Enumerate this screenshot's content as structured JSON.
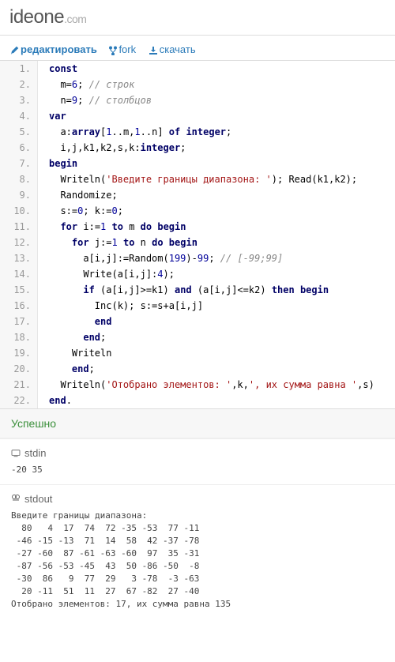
{
  "logo": {
    "main": "ideone",
    "ext": ".com"
  },
  "toolbar": {
    "edit_label": "редактировать",
    "fork_label": "fork",
    "download_label": "скачать"
  },
  "code_lines": [
    {
      "n": "1.",
      "html": "<span class='kw'>const</span>"
    },
    {
      "n": "2.",
      "html": "  m=<span class='num'>6</span>; <span class='cm'>// строк</span>"
    },
    {
      "n": "3.",
      "html": "  n=<span class='num'>9</span>; <span class='cm'>// столбцов</span>"
    },
    {
      "n": "4.",
      "html": "<span class='kw'>var</span>"
    },
    {
      "n": "5.",
      "html": "  a:<span class='kw'>array</span>[<span class='num'>1</span>..m,<span class='num'>1</span>..n] <span class='kw'>of</span> <span class='kw'>integer</span>;"
    },
    {
      "n": "6.",
      "html": "  i,j,k1,k2,s,k:<span class='kw'>integer</span>;"
    },
    {
      "n": "7.",
      "html": "<span class='kw'>begin</span>"
    },
    {
      "n": "8.",
      "html": "  Writeln(<span class='str'>'Введите границы диапазона: '</span>); Read(k1,k2);"
    },
    {
      "n": "9.",
      "html": "  Randomize;"
    },
    {
      "n": "10.",
      "html": "  s:=<span class='num'>0</span>; k:=<span class='num'>0</span>;"
    },
    {
      "n": "11.",
      "html": "  <span class='kw'>for</span> i:=<span class='num'>1</span> <span class='kw'>to</span> m <span class='kw'>do</span> <span class='kw'>begin</span>"
    },
    {
      "n": "12.",
      "html": "    <span class='kw'>for</span> j:=<span class='num'>1</span> <span class='kw'>to</span> n <span class='kw'>do</span> <span class='kw'>begin</span>"
    },
    {
      "n": "13.",
      "html": "      a[i,j]:=Random(<span class='num'>199</span>)-<span class='num'>99</span>; <span class='cm'>// [-99;99]</span>"
    },
    {
      "n": "14.",
      "html": "      Write(a[i,j]:<span class='num'>4</span>);"
    },
    {
      "n": "15.",
      "html": "      <span class='kw'>if</span> (a[i,j]&gt;=k1) <span class='kw'>and</span> (a[i,j]&lt;=k2) <span class='kw'>then</span> <span class='kw'>begin</span>"
    },
    {
      "n": "16.",
      "html": "        Inc(k); s:=s+a[i,j]"
    },
    {
      "n": "17.",
      "html": "        <span class='kw'>end</span>"
    },
    {
      "n": "18.",
      "html": "      <span class='kw'>end</span>;"
    },
    {
      "n": "19.",
      "html": "    Writeln"
    },
    {
      "n": "20.",
      "html": "    <span class='kw'>end</span>;"
    },
    {
      "n": "21.",
      "html": "  Writeln(<span class='str'>'Отобрано элементов: '</span>,k,<span class='str'>', их сумма равна '</span>,s)"
    },
    {
      "n": "22.",
      "html": "<span class='kw'>end</span>."
    }
  ],
  "status": "Успешно",
  "stdin": {
    "label": "stdin",
    "content": "-20 35"
  },
  "stdout": {
    "label": "stdout",
    "content": "Введите границы диапазона: \n  80   4  17  74  72 -35 -53  77 -11\n -46 -15 -13  71  14  58  42 -37 -78\n -27 -60  87 -61 -63 -60  97  35 -31\n -87 -56 -53 -45  43  50 -86 -50  -8\n -30  86   9  77  29   3 -78  -3 -63\n  20 -11  51  11  27  67 -82  27 -40\nОтобрано элементов: 17, их сумма равна 135"
  }
}
